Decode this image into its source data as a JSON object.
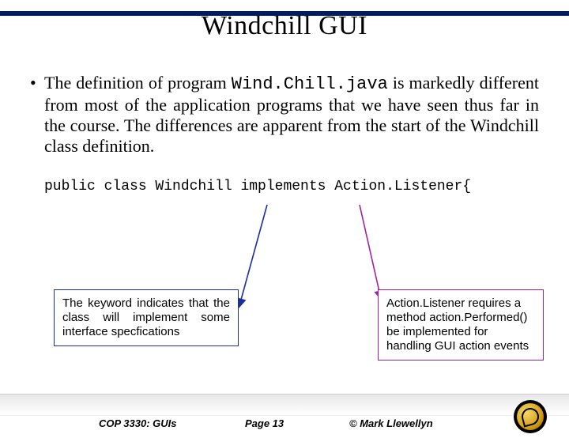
{
  "title": "Windchill GUI",
  "bullet": {
    "marker": "•",
    "text_before": "The definition of program ",
    "code": "Wind.Chill.java",
    "text_after": " is markedly different from most of the application programs that we have seen thus far in the course.  The differences are apparent from the start of the Windchill class definition."
  },
  "code_line": "public class Windchill implements Action.Listener{",
  "box_left": "The keyword indicates that the class will implement some interface specfications",
  "box_right": "Action.Listener requires a method action.Performed() be implemented for handling GUI action events",
  "footer": {
    "course": "COP 3330:  GUIs",
    "page": "Page 13",
    "copyright": "© Mark Llewellyn"
  }
}
